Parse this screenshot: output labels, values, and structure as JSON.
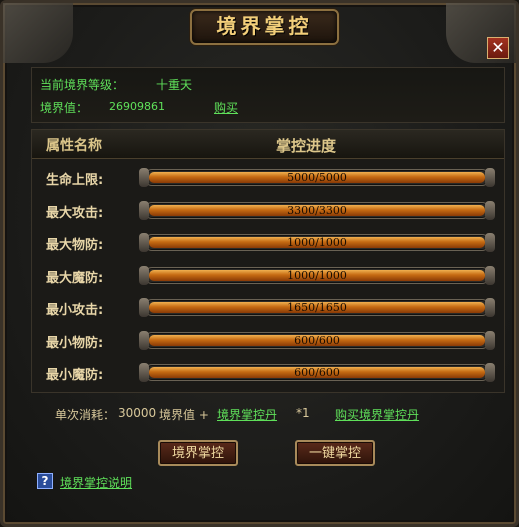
{
  "title": "境界掌控",
  "close_icon": "close-icon",
  "info": {
    "level_label": "当前境界等级：",
    "level_value": "十重天",
    "points_label": "境界值：",
    "points_value": "26909861",
    "buy_label": "购买"
  },
  "list": {
    "header_attr": "属性名称",
    "header_progress": "掌控进度",
    "rows": [
      {
        "label": "生命上限:",
        "text": "5000/5000",
        "progress": 1.0
      },
      {
        "label": "最大攻击:",
        "text": "3300/3300",
        "progress": 1.0
      },
      {
        "label": "最大物防:",
        "text": "1000/1000",
        "progress": 1.0
      },
      {
        "label": "最大魔防:",
        "text": "1000/1000",
        "progress": 1.0
      },
      {
        "label": "最小攻击:",
        "text": "1650/1650",
        "progress": 1.0
      },
      {
        "label": "最小物防:",
        "text": "600/600",
        "progress": 1.0
      },
      {
        "label": "最小魔防:",
        "text": "600/600",
        "progress": 1.0
      }
    ]
  },
  "cost": {
    "label": "单次消耗：",
    "amount": "30000",
    "unit": "境界值 +",
    "item_link": "境界掌控丹",
    "item_count": "*1",
    "buy_item_link": "购买境界掌控丹"
  },
  "buttons": {
    "control": "境界掌控",
    "one_click": "一键掌控"
  },
  "help": {
    "icon": "?",
    "link": "境界掌控说明"
  }
}
